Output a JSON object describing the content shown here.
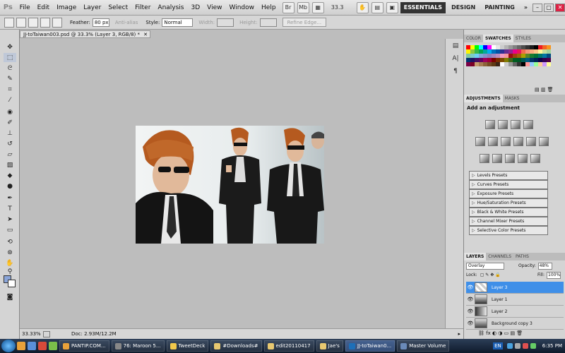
{
  "app": {
    "logo": "Ps",
    "menus": [
      "File",
      "Edit",
      "Image",
      "Layer",
      "Select",
      "Filter",
      "Analysis",
      "3D",
      "View",
      "Window",
      "Help"
    ],
    "mb_icons": [
      "bridge-icon",
      "mini-bridge-icon",
      "view-extras-icon"
    ],
    "zoom": "33.3",
    "workspaces": [
      "ESSENTIALS",
      "DESIGN",
      "PAINTING",
      "»"
    ],
    "window_controls": [
      "–",
      "▢",
      "✕"
    ]
  },
  "options": {
    "feather_label": "Feather:",
    "feather_value": "80 px",
    "antialias_label": "Anti-alias",
    "style_label": "Style:",
    "style_value": "Normal",
    "width_label": "Width:",
    "height_label": "Height:",
    "refine_label": "Refine Edge..."
  },
  "document": {
    "tab_title": "JJ-toTaiwan003.psd @ 33.3% (Layer 3, RGB/8) *",
    "tab_close": "✕"
  },
  "status": {
    "zoom": "33.33%",
    "doc_info": "Doc: 2.93M/12.2M"
  },
  "panels": {
    "color_tabs": [
      "COLOR",
      "SWATCHES",
      "STYLES"
    ],
    "adjust_tabs": [
      "ADJUSTMENTS",
      "MASKS"
    ],
    "adjust_title": "Add an adjustment",
    "presets": [
      "Levels Presets",
      "Curves Presets",
      "Exposure Presets",
      "Hue/Saturation Presets",
      "Black & White Presets",
      "Channel Mixer Presets",
      "Selective Color Presets"
    ],
    "layer_tabs": [
      "LAYERS",
      "CHANNELS",
      "PATHS"
    ],
    "blend_mode": "Overlay",
    "opacity_label": "Opacity:",
    "opacity_value": "48%",
    "lock_label": "Lock:",
    "fill_label": "Fill:",
    "fill_value": "100%",
    "layers": [
      {
        "name": "Layer 3",
        "selected": true
      },
      {
        "name": "Layer 1",
        "selected": false
      },
      {
        "name": "Layer 2",
        "selected": false
      },
      {
        "name": "Background copy 3",
        "selected": false
      }
    ]
  },
  "swatch_colors": [
    "#ff0000",
    "#ffff00",
    "#00ff00",
    "#00ffff",
    "#0000ff",
    "#ff00ff",
    "#ffffff",
    "#e6e6e6",
    "#cccccc",
    "#b3b3b3",
    "#999999",
    "#808080",
    "#666666",
    "#4d4d4d",
    "#333333",
    "#1a1a1a",
    "#000000",
    "#ed1c24",
    "#f26522",
    "#f7941d",
    "#fff200",
    "#8dc63f",
    "#39b54a",
    "#00a651",
    "#00a99d",
    "#00aeef",
    "#0072bc",
    "#0054a6",
    "#2e3192",
    "#662d91",
    "#92278f",
    "#ec008c",
    "#ed145b",
    "#f26c4f",
    "#f69679",
    "#f9ad81",
    "#fdc689",
    "#fff799",
    "#c4df9b",
    "#a3d39c",
    "#82ca9c",
    "#7accc8",
    "#6dcff6",
    "#7da7d9",
    "#8393ca",
    "#8781bd",
    "#a186be",
    "#bd8cbf",
    "#f49ac1",
    "#f5989d",
    "#9e0b0f",
    "#a0410d",
    "#a3620a",
    "#aba000",
    "#598527",
    "#197b30",
    "#007236",
    "#00746b",
    "#0076a3",
    "#004a80",
    "#003471",
    "#1b1464",
    "#440e62",
    "#630460",
    "#9e005d",
    "#9e0039",
    "#790000",
    "#7b2e00",
    "#7d4900",
    "#827b00",
    "#406618",
    "#005e20",
    "#005826",
    "#005952",
    "#005b7f",
    "#003663",
    "#002157",
    "#0d004c",
    "#32004b",
    "#4b0049",
    "#7b0046",
    "#7a0026",
    "#c69c6d",
    "#a67c52",
    "#8c6239",
    "#754c24",
    "#603913",
    "#3c2415",
    "#ffffff",
    "#cccccc",
    "#999999",
    "#666666",
    "#333333",
    "#000000",
    "#ff9999",
    "#99ccff",
    "#99ff99",
    "#ffcc99",
    "#cc99ff",
    "#ffff99"
  ],
  "taskbar": {
    "tasks": [
      {
        "label": "PANTIP.COM...",
        "color": "#e8a13a",
        "active": false
      },
      {
        "label": "76: Maroon 5...",
        "color": "#888",
        "active": false
      },
      {
        "label": "TweetDeck",
        "color": "#f2c84b",
        "active": false
      },
      {
        "label": "#Downloads#",
        "color": "#e8c870",
        "active": false
      },
      {
        "label": "edit20110417",
        "color": "#e8c870",
        "active": false
      },
      {
        "label": "Jae's",
        "color": "#e8c870",
        "active": false
      },
      {
        "label": "JJ-toTaiwan0...",
        "color": "#1e6fb8",
        "active": true
      },
      {
        "label": "Master Volume",
        "color": "#6a8ab8",
        "active": false
      }
    ],
    "lang": "EN",
    "time": "6:35 PM"
  }
}
